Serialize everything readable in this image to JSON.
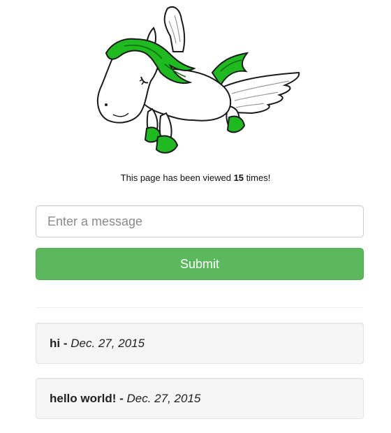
{
  "logo": {
    "icon": "pegasus-logo-icon",
    "mane_color": "#1fba1f",
    "outline_color": "#1a1a1a"
  },
  "view_counter": {
    "prefix": "This page has been viewed",
    "count": "15",
    "suffix": "times!"
  },
  "form": {
    "message_placeholder": "Enter a message",
    "message_value": "",
    "submit_label": "Submit",
    "submit_color": "#5cb85c"
  },
  "messages": [
    {
      "text": "hi",
      "separator": " - ",
      "date": "Dec. 27, 2015"
    },
    {
      "text": "hello world!",
      "separator": " - ",
      "date": "Dec. 27, 2015"
    }
  ]
}
